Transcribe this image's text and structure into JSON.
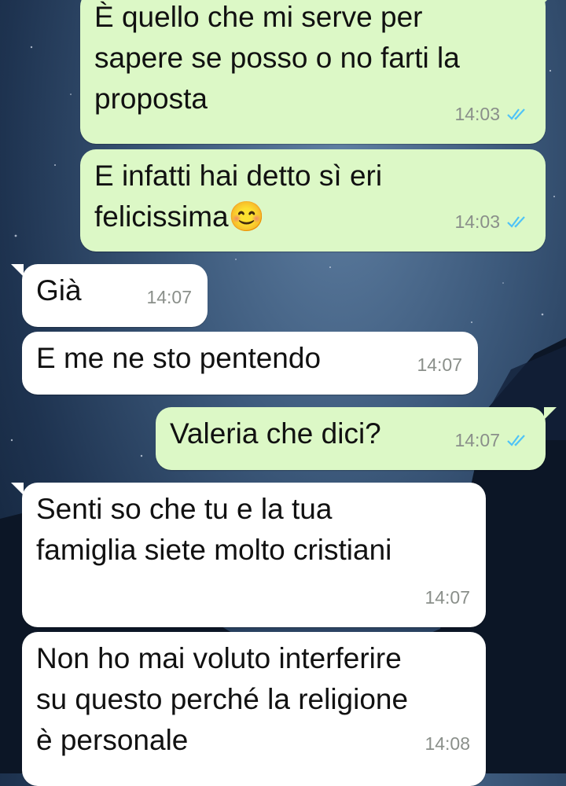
{
  "conversation": {
    "messages": [
      {
        "direction": "outgoing",
        "text": "È quello che mi serve per\nsapere se posso o no farti la\nproposta",
        "time": "14:03",
        "status": "read-ticks-icon"
      },
      {
        "direction": "outgoing",
        "text": "E infatti hai detto sì eri\nfelicissima",
        "emoji": "😊",
        "time": "14:03",
        "status": "read-ticks-icon"
      },
      {
        "direction": "incoming",
        "text": "Già",
        "time": "14:07"
      },
      {
        "direction": "incoming",
        "text": "E me ne sto pentendo",
        "time": "14:07"
      },
      {
        "direction": "outgoing",
        "text": "Valeria che dici?",
        "time": "14:07",
        "status": "read-ticks-icon"
      },
      {
        "direction": "incoming",
        "text": "Senti so che tu e la tua\nfamiglia siete molto cristiani",
        "time": "14:07"
      },
      {
        "direction": "incoming",
        "text": "Non ho mai voluto interferire\nsu questo perché la religione\nè personale",
        "time": "14:08"
      }
    ]
  },
  "colors": {
    "outgoing_bubble": "#dcf8c6",
    "incoming_bubble": "#ffffff",
    "read_ticks": "#4fc3f7",
    "timestamp": "#8a8f8a"
  }
}
